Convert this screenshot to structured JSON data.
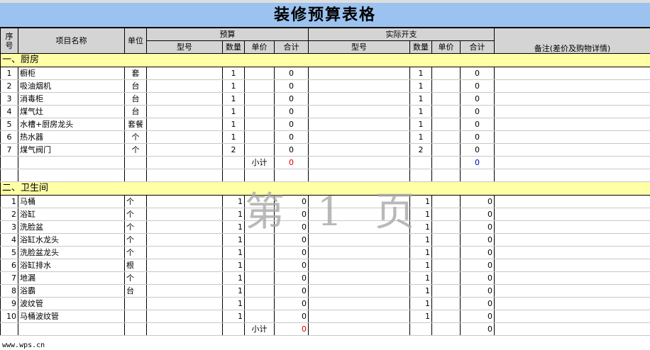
{
  "title": "装修预算表格",
  "header": {
    "seq": "序号",
    "item": "项目名称",
    "unit": "单位",
    "budget": "预算",
    "actual": "实际开支",
    "model": "型号",
    "qty": "数量",
    "price": "单价",
    "total": "合计",
    "note": "备注(差价及购物详情)"
  },
  "sections": [
    {
      "name": "一、厨房",
      "rows": [
        {
          "no": "1",
          "name": "橱柜",
          "unit": "套",
          "qty": "1",
          "total": "0",
          "aqty": "1",
          "atotal": "0"
        },
        {
          "no": "2",
          "name": "吸油烟机",
          "unit": "台",
          "qty": "1",
          "total": "0",
          "aqty": "1",
          "atotal": "0"
        },
        {
          "no": "3",
          "name": "消毒柜",
          "unit": "台",
          "qty": "1",
          "total": "0",
          "aqty": "1",
          "atotal": "0"
        },
        {
          "no": "4",
          "name": "煤气灶",
          "unit": "台",
          "qty": "1",
          "total": "0",
          "aqty": "1",
          "atotal": "0"
        },
        {
          "no": "5",
          "name": "水槽+厨房龙头",
          "unit": "套餐",
          "qty": "1",
          "total": "0",
          "aqty": "1",
          "atotal": "0"
        },
        {
          "no": "6",
          "name": "热水器",
          "unit": "个",
          "qty": "1",
          "total": "0",
          "aqty": "1",
          "atotal": "0"
        },
        {
          "no": "7",
          "name": "煤气阀门",
          "unit": "个",
          "qty": "2",
          "total": "0",
          "aqty": "2",
          "atotal": "0"
        }
      ],
      "subtotal_label": "小计",
      "subtotal": "0",
      "asubtotal": "0"
    },
    {
      "name": "二、卫生间",
      "rows": [
        {
          "no": "1",
          "name": "马桶",
          "unit": "个",
          "qty": "1",
          "total": "0",
          "aqty": "1",
          "atotal": "0"
        },
        {
          "no": "2",
          "name": "浴缸",
          "unit": "个",
          "qty": "1",
          "total": "0",
          "aqty": "1",
          "atotal": "0"
        },
        {
          "no": "3",
          "name": "洗脸盆",
          "unit": "个",
          "qty": "1",
          "total": "0",
          "aqty": "1",
          "atotal": "0"
        },
        {
          "no": "4",
          "name": "浴缸水龙头",
          "unit": "个",
          "qty": "1",
          "total": "0",
          "aqty": "1",
          "atotal": "0"
        },
        {
          "no": "5",
          "name": "洗脸盆龙头",
          "unit": "个",
          "qty": "1",
          "total": "0",
          "aqty": "1",
          "atotal": "0"
        },
        {
          "no": "6",
          "name": "浴缸排水",
          "unit": "根",
          "qty": "1",
          "total": "0",
          "aqty": "1",
          "atotal": "0"
        },
        {
          "no": "7",
          "name": "地漏",
          "unit": "个",
          "qty": "1",
          "total": "0",
          "aqty": "1",
          "atotal": "0"
        },
        {
          "no": "8",
          "name": "浴霸",
          "unit": "台",
          "qty": "1",
          "total": "0",
          "aqty": "1",
          "atotal": "0"
        },
        {
          "no": "9",
          "name": "波纹管",
          "unit": "",
          "qty": "1",
          "total": "0",
          "aqty": "1",
          "atotal": "0"
        },
        {
          "no": "10",
          "name": "马桶波纹管",
          "unit": "",
          "qty": "1",
          "total": "0",
          "aqty": "1",
          "atotal": "0"
        }
      ],
      "subtotal_label": "小计",
      "subtotal": "0",
      "asubtotal": "0"
    }
  ],
  "watermark": "第 1 页",
  "footer": "www.wps.cn",
  "colors": {
    "title_bg": "#9cc3f0",
    "section_bg": "#ffffa6",
    "header_bg": "#d4d4d4"
  }
}
